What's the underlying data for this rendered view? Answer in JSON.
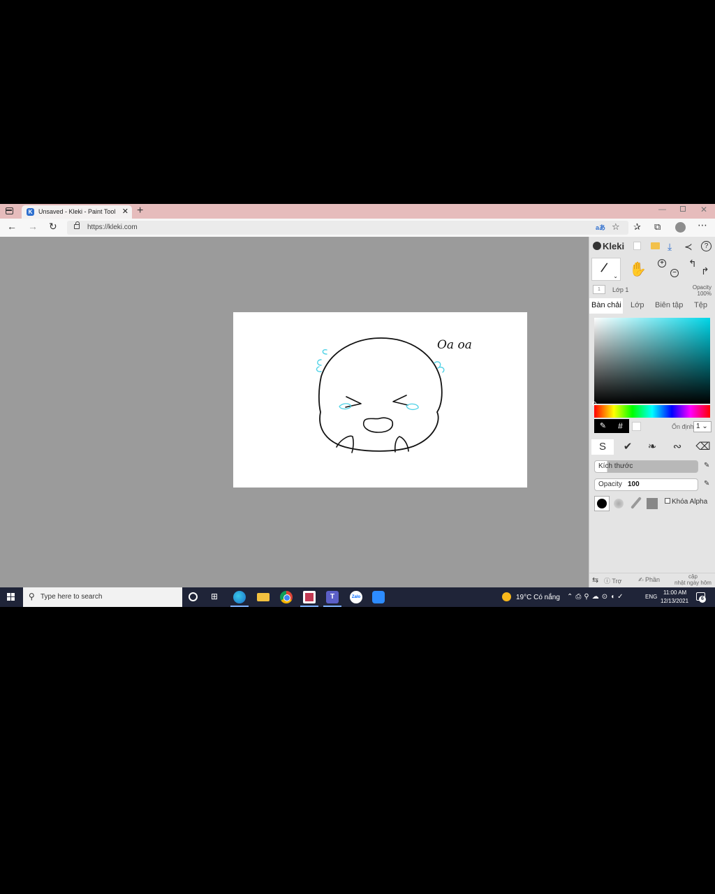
{
  "browser": {
    "tab_title": "Unsaved - Kleki - Paint Tool",
    "url": "https://kleki.com",
    "tab_close": "✕",
    "new_tab": "+",
    "read_aloud": "aあ"
  },
  "app": {
    "logo": "Kleki",
    "help": "?",
    "layer_thumb": "1",
    "layer_name": "Lớp 1",
    "layer_opacity_label": "Opacity",
    "layer_opacity_value": "100%",
    "tabs": [
      {
        "label": "Bàn chải",
        "active": true
      },
      {
        "label": "Lớp",
        "active": false
      },
      {
        "label": "Biên tập",
        "active": false
      },
      {
        "label": "Tệp",
        "active": false
      }
    ],
    "color": {
      "current": "#000000",
      "picker_hue": "#00d6e8",
      "hex_button": "#",
      "stabilizer_label": "Ổn định",
      "stabilizer_value": "1"
    },
    "brush": {
      "size_label": "Kích thước",
      "size_fraction": 0.12,
      "opacity_label": "Opacity",
      "opacity_value": "100",
      "alpha_lock_label": "Khóa Alpha",
      "alpha_lock_checked": false
    },
    "footer": {
      "help": "Trợ",
      "share": "Phần",
      "update_line1": "cập",
      "update_line2": "nhật ngày hôm"
    }
  },
  "drawing": {
    "caption": "Oa oa",
    "stroke_color": "#111111",
    "tear_color": "#4fd2e6"
  },
  "taskbar": {
    "search_placeholder": "Type here to search",
    "teams_badge": "T",
    "zalo_label": "Zalo",
    "weather": "19°C  Có nắng",
    "language": "ENG",
    "time": "11:00 AM",
    "date": "12/13/2021",
    "notification_count": "6"
  }
}
